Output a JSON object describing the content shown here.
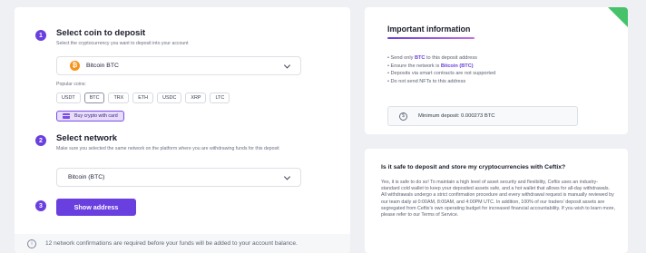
{
  "step1": {
    "number": "1",
    "title": "Select coin to deposit",
    "subtitle": "Select the cryptocurrency you want to deposit into your account",
    "selected_coin": "Bitcoin BTC",
    "coin_icon": "bitcoin-icon",
    "popular_label": "Popular coins:",
    "popular_coins": [
      "USDT",
      "BTC",
      "TRX",
      "ETH",
      "USDC",
      "XRP",
      "LTC"
    ],
    "active_coin": "BTC",
    "buy_label": "Buy crypto with card"
  },
  "step2": {
    "number": "2",
    "title": "Select network",
    "subtitle": "Make sure you selected the same network on the platform where you are withdrawing funds for this deposit",
    "selected_network": "Bitcoin (BTC)"
  },
  "step3": {
    "number": "3",
    "button_label": "Show address"
  },
  "footer_note": "12 network confirmations are required before your funds will be added to your account balance.",
  "important": {
    "title": "Important information",
    "bullet1_pre": "Send only ",
    "bullet1_hl": "BTC",
    "bullet1_post": " to this deposit address",
    "bullet2_pre": "Ensure the network is ",
    "bullet2_hl": "Bitcoin (BTC)",
    "bullet3": "Deposits via smart contracts are not supported",
    "bullet4": "Do not send NFTs to this address",
    "min_deposit": "Minimum deposit: 0.000273 BTC"
  },
  "faq": {
    "question": "Is it safe to deposit and store my cryptocurrencies with Ceftix?",
    "answer": "Yes, it is safe to do so! To maintain a high level of asset security and flexibility, Ceftix uses an industry-standard cold wallet to keep your deposited assets safe, and a hot wallet that allows for all-day withdrawals. All withdrawals undergo a strict confirmation procedure and every withdrawal request is manually reviewed by our team daily at 0:00AM, 8:00AM, and 4:00PM UTC. In addition, 100% of our traders' deposit assets are segregated from Ceftix's own operating budget for increased financial accountability. If you wish to learn more, please refer to our Terms of Service."
  },
  "colors": {
    "accent": "#6a3fe0",
    "corner_badge": "#45c26a",
    "bitcoin": "#f7931a"
  }
}
